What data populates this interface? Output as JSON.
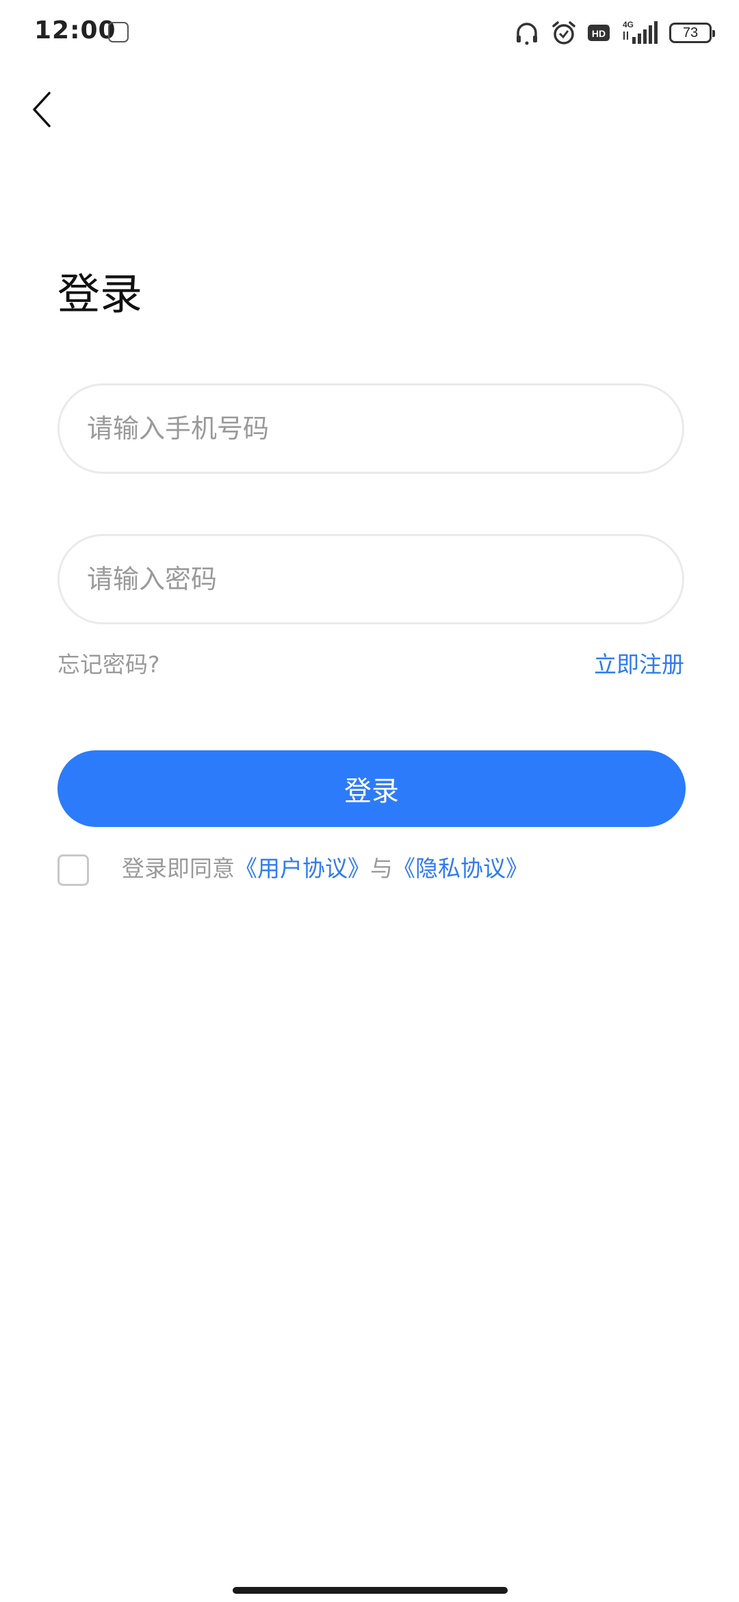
{
  "status_bar": {
    "time": "12:00",
    "network": "4G",
    "hd": "HD",
    "battery": "73",
    "icons": [
      "app-notification-icon",
      "headset-icon",
      "alarm-icon",
      "hd-icon",
      "signal-icon",
      "battery-icon"
    ]
  },
  "nav": {
    "back_icon": "chevron-left-icon"
  },
  "login": {
    "title": "登录",
    "phone_placeholder": "请输入手机号码",
    "phone_value": "",
    "password_placeholder": "请输入密码",
    "password_value": "",
    "forgot_password": "忘记密码?",
    "register_now": "立即注册",
    "submit_label": "登录"
  },
  "agreement": {
    "checked": false,
    "prefix": "登录即同意",
    "user_agreement": "《用户协议》",
    "conjunction": "与",
    "privacy_agreement": "《隐私协议》"
  },
  "colors": {
    "accent": "#2c7bfb",
    "link": "#2f7bf0",
    "muted_text": "#9a9a9a",
    "border": "#eaeaea"
  }
}
